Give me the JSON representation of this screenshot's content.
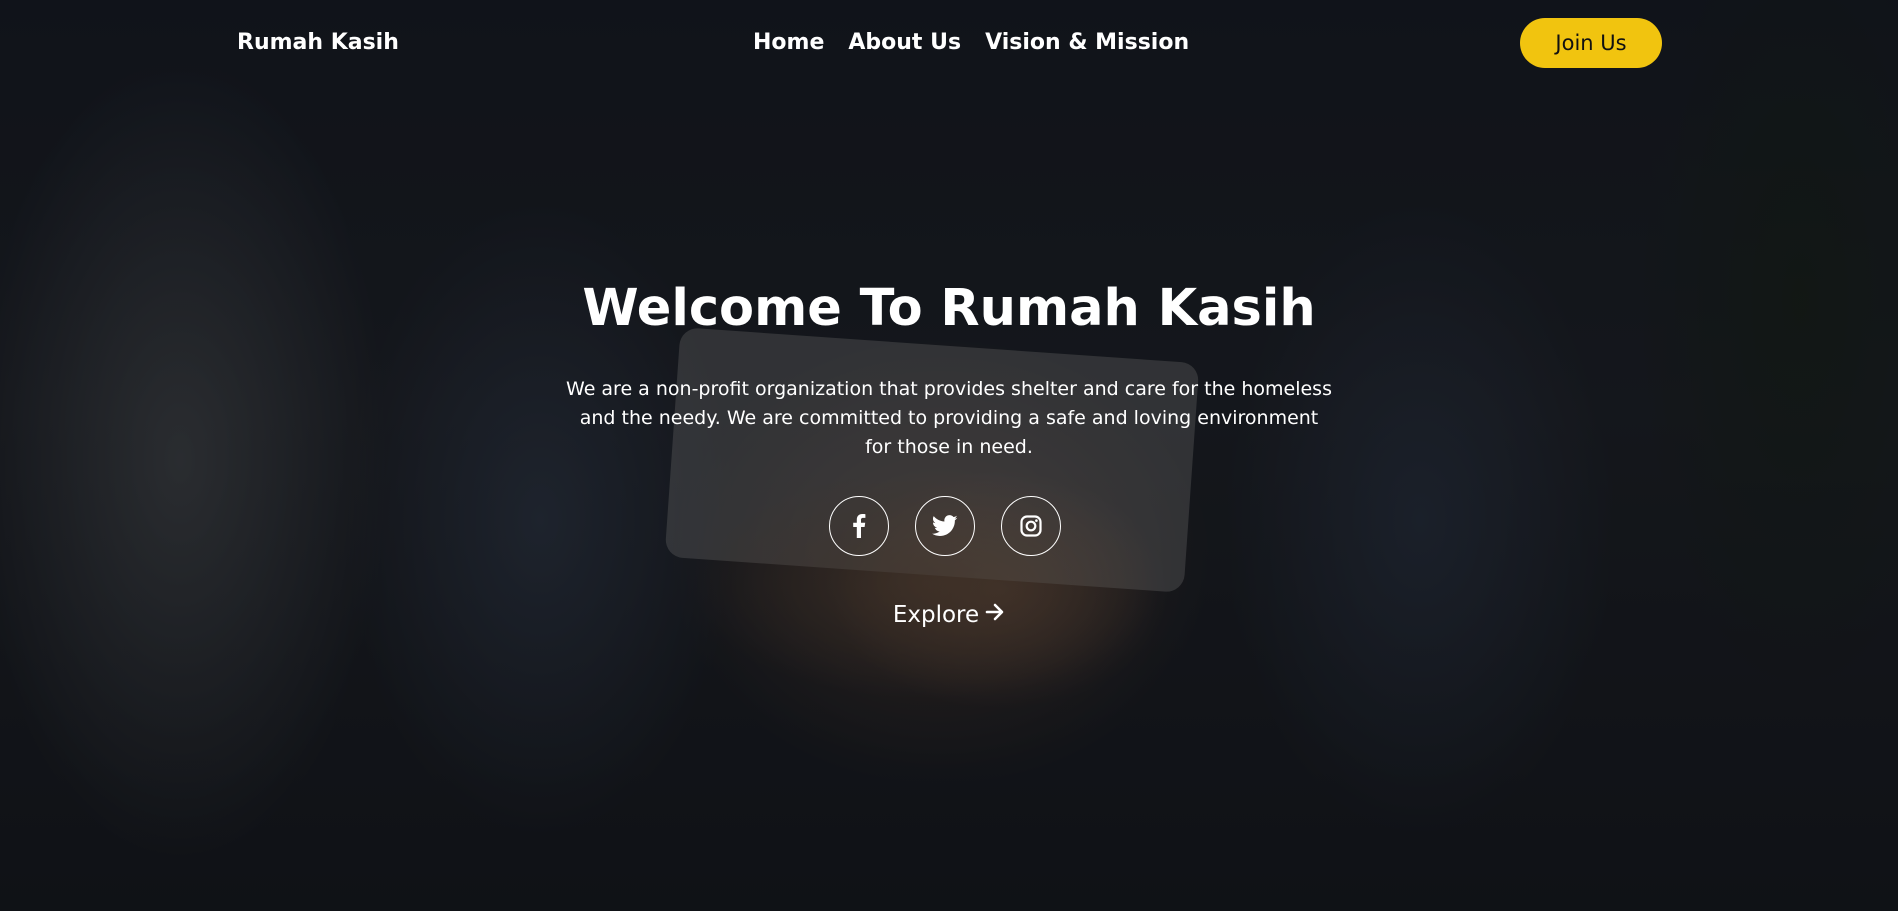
{
  "header": {
    "brand": "Rumah Kasih",
    "nav": [
      "Home",
      "About Us",
      "Vision & Mission"
    ],
    "cta_label": "Join Us"
  },
  "hero": {
    "title": "Welcome To Rumah Kasih",
    "description": "We are a non-profit organization that provides shelter and care for the homeless and the needy. We are committed to providing a safe and loving environment for those in need.",
    "socials": [
      "facebook-icon",
      "twitter-icon",
      "instagram-icon"
    ],
    "explore_label": "Explore",
    "explore_icon": "arrow-right-icon"
  },
  "colors": {
    "accent": "#f1c40f",
    "text": "#ffffff"
  }
}
